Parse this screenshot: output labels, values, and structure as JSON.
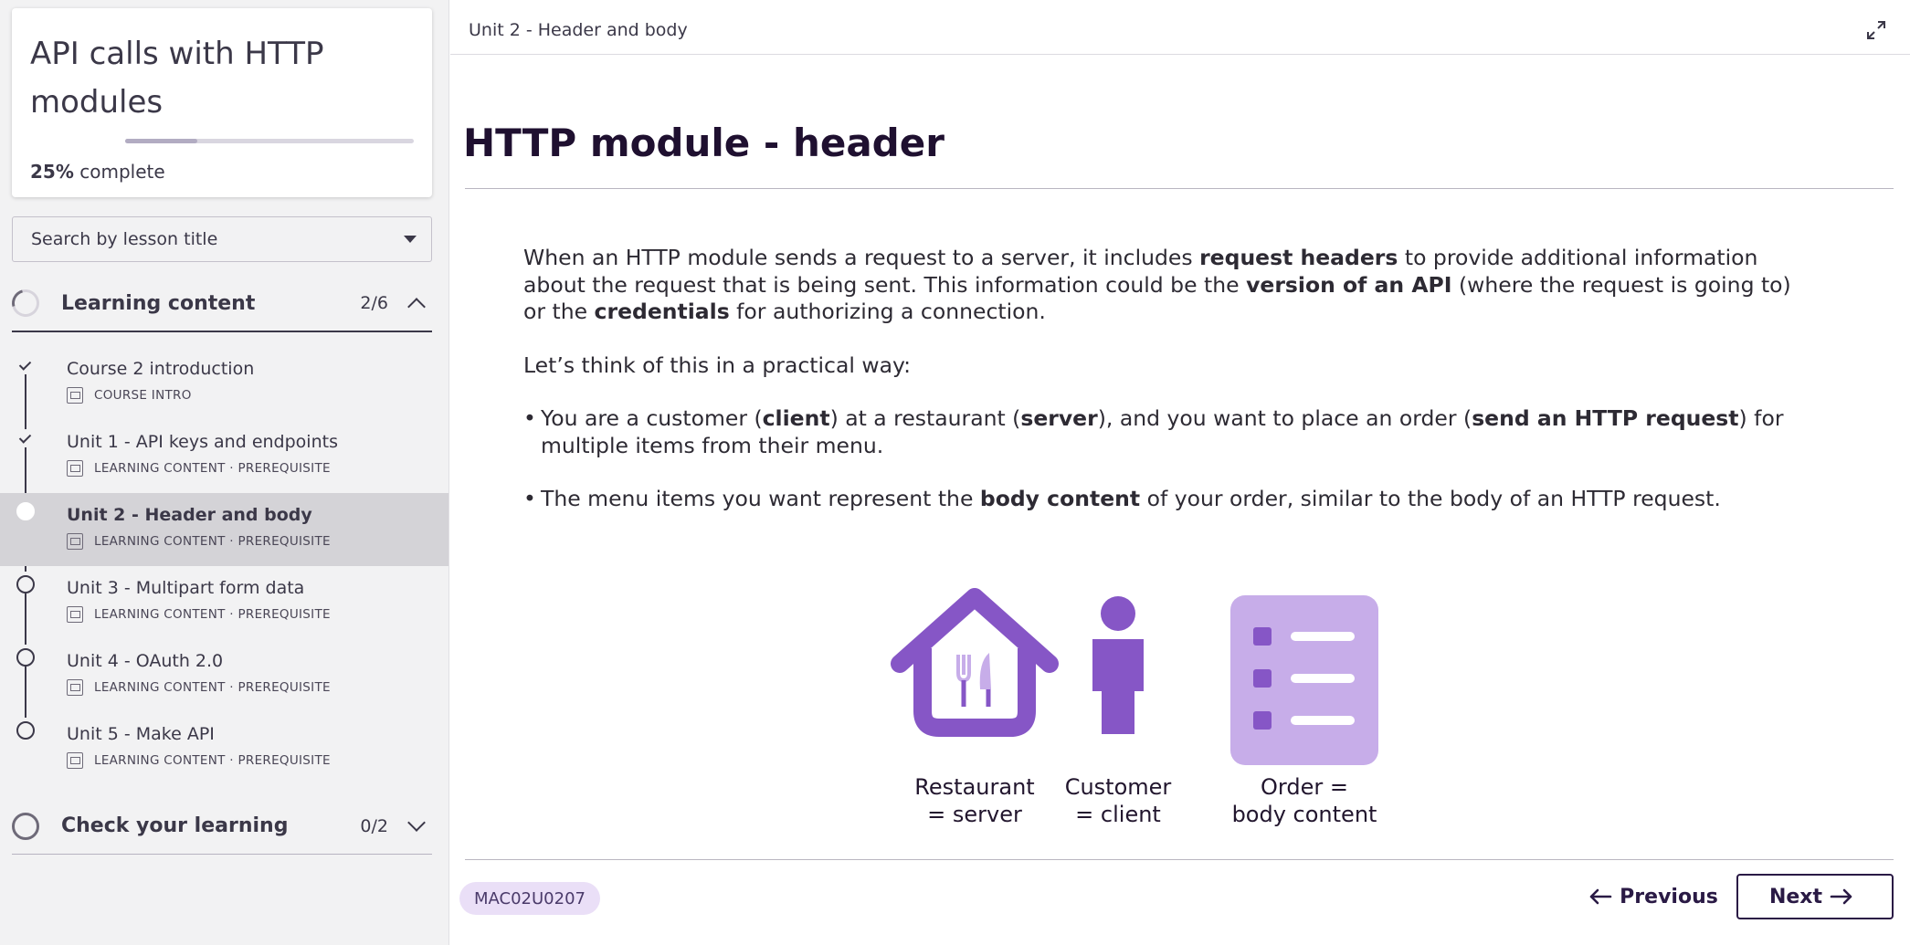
{
  "course": {
    "title": "API calls with HTTP modules",
    "progress_percent": "25%",
    "progress_suffix": " complete",
    "progress_fraction": 0.25
  },
  "search": {
    "placeholder": "Search by lesson title"
  },
  "sections": {
    "learning": {
      "label": "Learning content",
      "count": "2/6",
      "expanded": true
    },
    "check": {
      "label": "Check your learning",
      "count": "0/2",
      "expanded": false
    }
  },
  "lessons": [
    {
      "title": "Course 2 introduction",
      "meta": "COURSE INTRO",
      "status": "done"
    },
    {
      "title": "Unit 1 - API keys and endpoints",
      "meta": "LEARNING CONTENT · PREREQUISITE",
      "status": "done"
    },
    {
      "title": "Unit 2 - Header and body",
      "meta": "LEARNING CONTENT · PREREQUISITE",
      "status": "current"
    },
    {
      "title": "Unit 3 - Multipart form data",
      "meta": "LEARNING CONTENT · PREREQUISITE",
      "status": "todo"
    },
    {
      "title": "Unit 4 - OAuth 2.0",
      "meta": "LEARNING CONTENT · PREREQUISITE",
      "status": "todo"
    },
    {
      "title": "Unit 5 - Make API",
      "meta": "LEARNING CONTENT · PREREQUISITE",
      "status": "todo"
    }
  ],
  "main": {
    "breadcrumb": "Unit 2 - Header and body",
    "page_title": "HTTP module - header",
    "para1": {
      "t1": "When an HTTP module sends a request to a server, it includes ",
      "b1": "request headers",
      "t2": " to provide additional information about the request that is being sent. This information could be the ",
      "b2": "version of an API",
      "t3": " (where the request is going to) or the ",
      "b3": "credentials",
      "t4": " for authorizing a connection."
    },
    "para2": "Let’s think of this in a practical way:",
    "bullet1": {
      "t1": "You are a customer (",
      "b1": "client",
      "t2": ") at a restaurant (",
      "b2": "server",
      "t3": "), and you want to place an order (",
      "b3": "send an HTTP request",
      "t4": ") for multiple items from their menu."
    },
    "bullet2": {
      "t1": "The menu items you want represent the ",
      "b1": "body content",
      "t2": " of your order, similar to the body of an HTTP request."
    },
    "illustration": {
      "customer": [
        "Customer",
        "= client"
      ],
      "restaurant": [
        "Restaurant",
        "= server"
      ],
      "order": [
        "Order =",
        "body content"
      ]
    },
    "code": "MAC02U0207",
    "prev_label": "Previous",
    "next_label": "Next"
  },
  "colors": {
    "accent_purple": "#8656c6",
    "light_purple": "#c7ade9",
    "dark_text": "#1f1030",
    "active_row": "#d4d3d7"
  },
  "icons": {
    "bullet": "•",
    "expand": "expand-icon",
    "arrow_left": "arrow-left-icon",
    "arrow_right": "arrow-right-icon"
  }
}
